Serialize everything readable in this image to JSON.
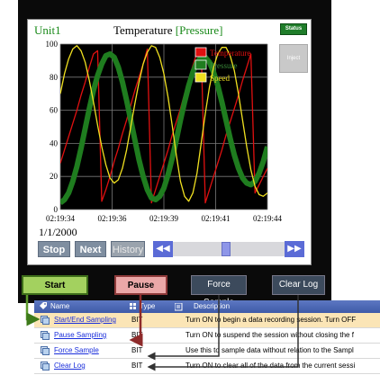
{
  "panel": {
    "unit_label": "Unit1",
    "title_prefix": "Temperature ",
    "title_open": "[",
    "title_highlight": "Pressure",
    "title_close": "]",
    "status_label": "Status",
    "inject_label": "Inject",
    "date": "1/1/2000",
    "buttons": {
      "stop": "Stop",
      "next": "Next",
      "history": "History"
    },
    "scroll": {
      "left_icon": "double-left-arrow",
      "right_icon": "double-right-arrow",
      "left_glyph": "◀◀",
      "right_glyph": "▶▶",
      "position": 0.47
    }
  },
  "chart_data": {
    "type": "line",
    "title": "",
    "xlabel": "",
    "ylabel": "",
    "ylim": [
      0,
      100
    ],
    "yticks": [
      0,
      20,
      40,
      60,
      80,
      100
    ],
    "xticks": [
      "02:19:34",
      "02:19:36",
      "02:19:39",
      "02:19:41",
      "02:19:44"
    ],
    "grid": true,
    "legend_position": "top-right",
    "x": [
      0,
      0.2,
      0.4,
      0.6,
      0.8,
      1,
      1.2,
      1.4,
      1.6,
      1.8,
      2,
      2.2,
      2.4,
      2.6,
      2.8,
      3,
      3.2,
      3.4,
      3.6,
      3.8,
      4,
      4.2,
      4.4,
      4.6,
      4.8,
      5,
      5.2,
      5.4,
      5.6,
      5.8,
      6,
      6.2,
      6.4,
      6.6,
      6.8,
      7,
      7.2,
      7.4,
      7.6,
      7.8,
      8,
      8.2,
      8.4,
      8.6,
      8.8,
      9,
      9.2,
      9.4,
      9.6,
      9.8,
      10
    ],
    "series": [
      {
        "name": "Temperature",
        "color": "#e01010",
        "width": 1.3,
        "values": [
          28,
          36,
          44,
          52,
          60,
          69,
          77,
          86,
          94,
          96,
          5,
          12,
          20,
          29,
          37,
          46,
          54,
          63,
          72,
          80,
          88,
          97,
          4,
          12,
          20,
          28,
          36,
          45,
          53,
          61,
          70,
          78,
          87,
          95,
          97,
          4,
          12,
          20,
          28,
          36,
          45,
          53,
          61,
          69,
          78,
          86,
          94,
          10,
          15,
          20,
          25
        ]
      },
      {
        "name": "Pressure",
        "color": "#1f7d1f",
        "width": 6,
        "values": [
          4,
          6,
          10,
          17,
          26,
          37,
          49,
          61,
          72,
          81,
          88,
          93,
          94,
          92,
          86,
          77,
          66,
          54,
          42,
          30,
          20,
          12,
          7,
          6,
          8,
          13,
          21,
          31,
          42,
          54,
          65,
          75,
          83,
          89,
          92,
          92,
          89,
          83,
          75,
          65,
          54,
          43,
          33,
          25,
          19,
          16,
          15,
          17,
          22,
          29,
          38
        ]
      },
      {
        "name": "Speed",
        "color": "#f0e020",
        "width": 1.3,
        "values": [
          70,
          82,
          91,
          97,
          99,
          96,
          89,
          78,
          65,
          51,
          38,
          27,
          19,
          16,
          18,
          25,
          36,
          50,
          64,
          77,
          88,
          95,
          99,
          98,
          92,
          82,
          68,
          51,
          33,
          17,
          8,
          5,
          10,
          22,
          40,
          58,
          74,
          86,
          94,
          98,
          98,
          93,
          84,
          70,
          54,
          38,
          24,
          14,
          9,
          8,
          10
        ]
      }
    ]
  },
  "callouts": {
    "start": "Start Sampling",
    "pause": "Pause",
    "force": "Force Sample",
    "clear": "Clear Log"
  },
  "table": {
    "headers": {
      "name": "Name",
      "type": "Type",
      "description": "Description"
    },
    "rows": [
      {
        "name": "Start/End Sampling",
        "type": "BIT",
        "description": "Turn ON to begin a data recording session. Turn OFF",
        "selected": true
      },
      {
        "name": "Pause Sampling",
        "type": "BIT",
        "description": "Turn ON to suspend the session without closing the f",
        "selected": false
      },
      {
        "name": "Force Sample",
        "type": "BIT",
        "description": "Use this to sample data without relation to the Sampl",
        "selected": false
      },
      {
        "name": "Clear Log",
        "type": "BIT",
        "description": "Turn ON to clear all of the data from the current sessi",
        "selected": false
      }
    ]
  }
}
